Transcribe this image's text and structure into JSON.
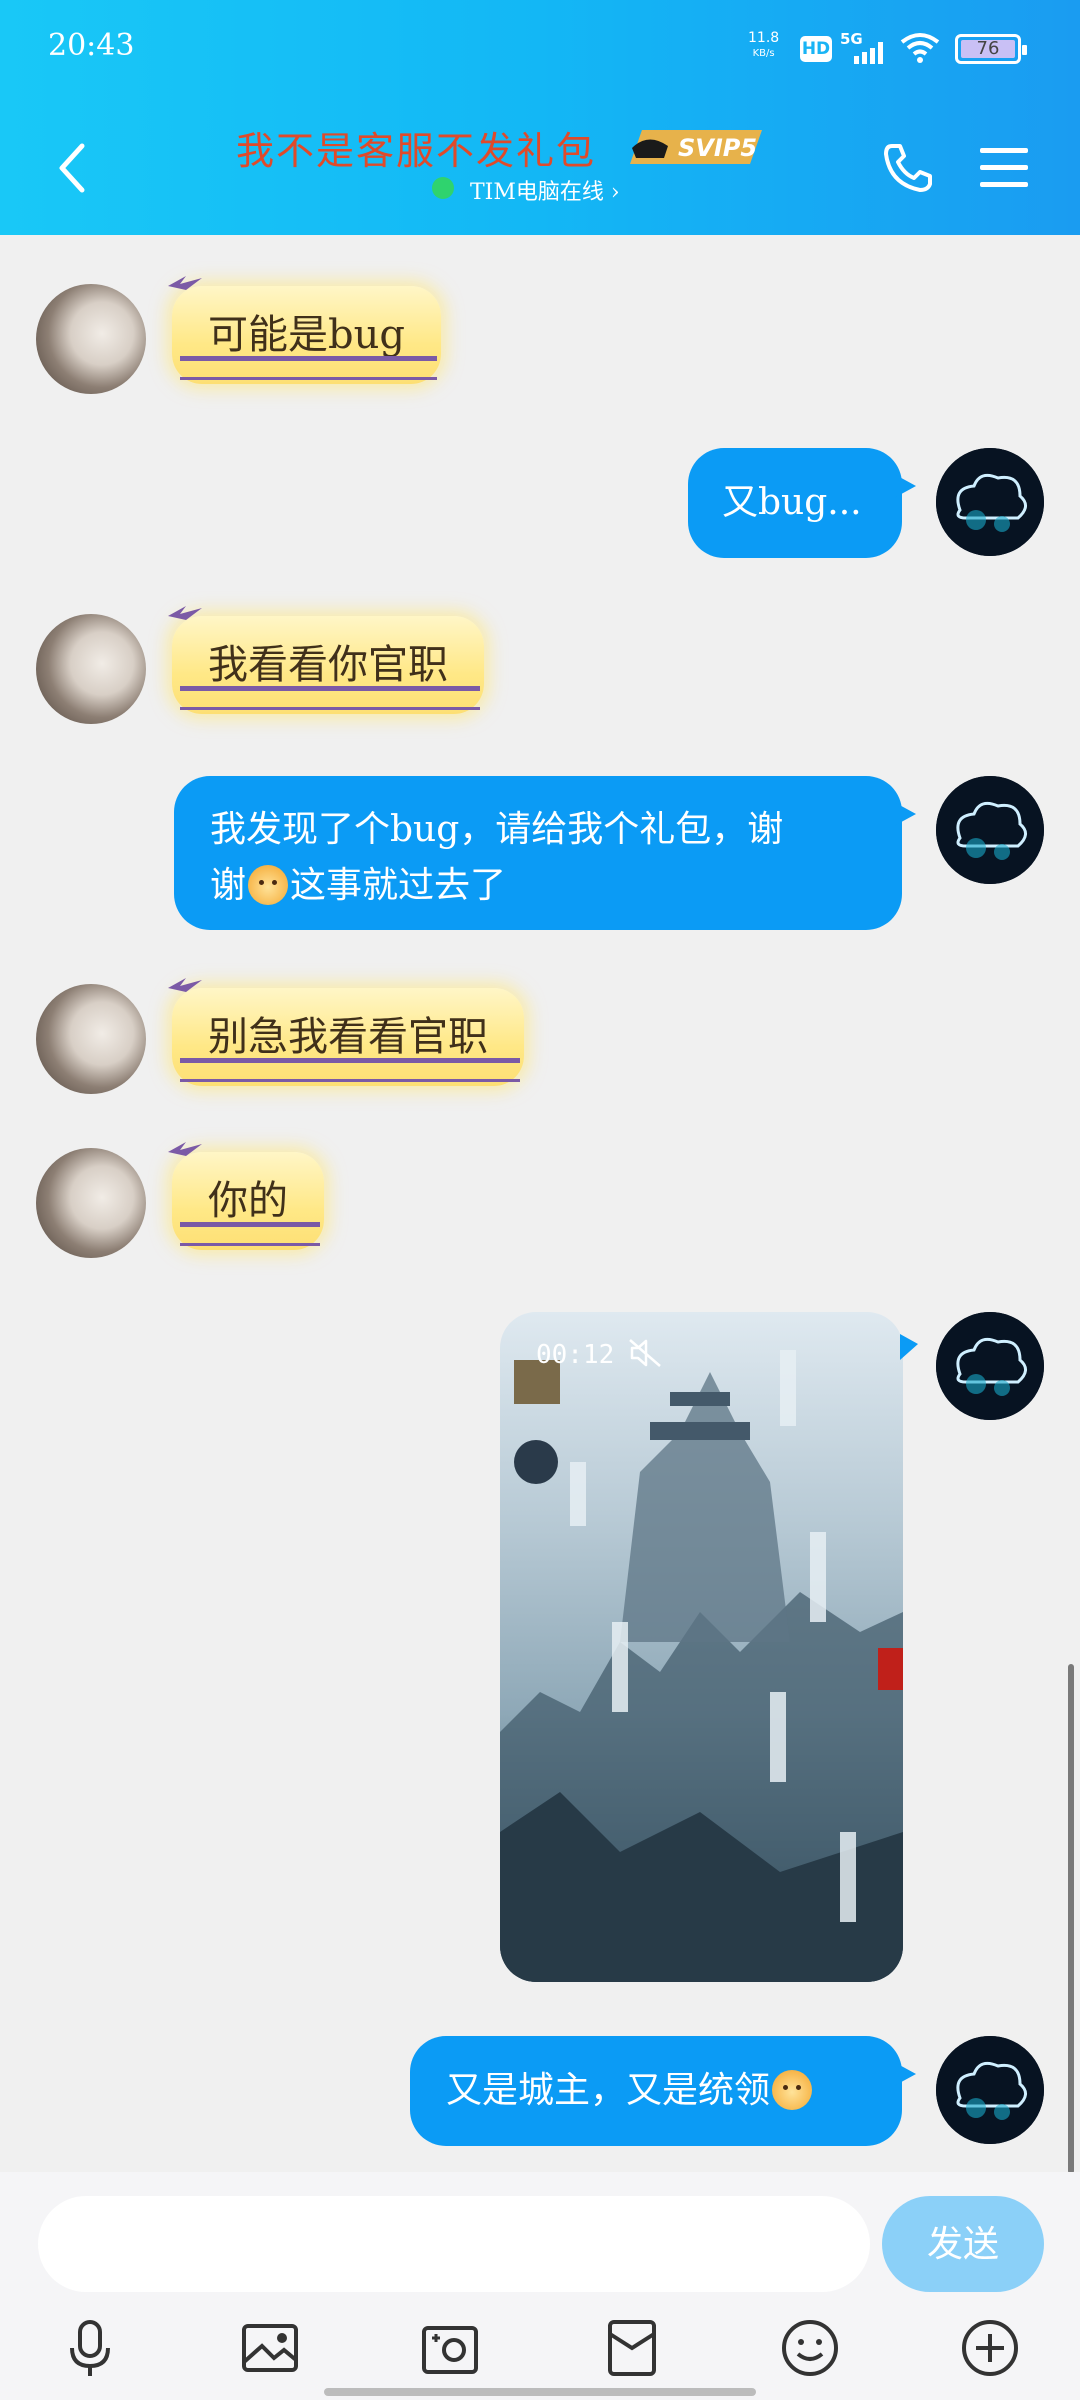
{
  "status_bar": {
    "time": "20:43",
    "net_speed_value": "11.8",
    "net_speed_unit": "KB/s",
    "hd": "HD",
    "network": "5G",
    "battery": "76"
  },
  "header": {
    "title": "我不是客服不发礼包",
    "vip_badge": "SVIP5",
    "status_text": "TIM电脑在线"
  },
  "messages": [
    {
      "side": "left",
      "text": "可能是bug"
    },
    {
      "side": "right",
      "text": "又bug..."
    },
    {
      "side": "left",
      "text": "我看看你官职"
    },
    {
      "side": "right",
      "line1": "我发现了个bug，请给我个礼包，谢",
      "line2_a": "谢",
      "line2_b": "这事就过去了"
    },
    {
      "side": "left",
      "text": "别急我看看官职"
    },
    {
      "side": "left",
      "text": "你的"
    },
    {
      "side": "right",
      "type": "video",
      "duration": "00:12"
    },
    {
      "side": "right",
      "text": "又是城主，又是统领"
    }
  ],
  "input": {
    "placeholder": "",
    "send_label": "发送"
  },
  "toolbar": [
    "mic-icon",
    "image-icon",
    "camera-icon",
    "red-packet-icon",
    "emoji-icon",
    "plus-icon"
  ]
}
